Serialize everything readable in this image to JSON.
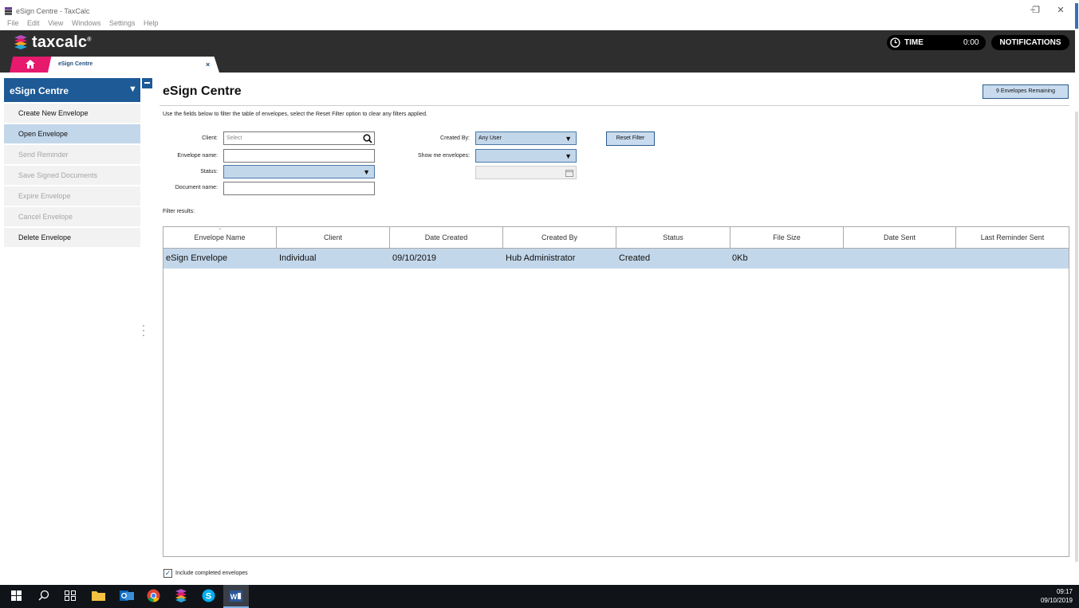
{
  "window": {
    "title": "eSign Centre - TaxCalc",
    "menu": [
      "File",
      "Edit",
      "View",
      "Windows",
      "Settings",
      "Help"
    ],
    "controls": {
      "minimize": "–",
      "restore": "❐",
      "close": "✕"
    }
  },
  "header": {
    "logo_text": "taxcalc",
    "logo_mark": "®",
    "time_label": "TIME",
    "time_value": "0:00",
    "notifications_label": "NOTIFICATIONS"
  },
  "tabs": {
    "active_label": "eSign Centre",
    "close_glyph": "×"
  },
  "sidebar": {
    "title": "eSign Centre",
    "collapse_glyph": "▼",
    "items": [
      {
        "label": "Create New Envelope",
        "enabled": true,
        "selected": false
      },
      {
        "label": "Open Envelope",
        "enabled": true,
        "selected": true
      },
      {
        "label": "Send Reminder",
        "enabled": false,
        "selected": false
      },
      {
        "label": "Save Signed Documents",
        "enabled": false,
        "selected": false
      },
      {
        "label": "Expire Envelope",
        "enabled": false,
        "selected": false
      },
      {
        "label": "Cancel Envelope",
        "enabled": false,
        "selected": false
      },
      {
        "label": "Delete Envelope",
        "enabled": true,
        "selected": false
      }
    ]
  },
  "main": {
    "title": "eSign Centre",
    "envelopes_remaining": "9 Envelopes Remaining",
    "instructions": "Use the fields below to filter the table of envelopes, select the Reset Filter option to clear any filters applied.",
    "filters": {
      "client_label": "Client:",
      "client_placeholder": "Select",
      "envelope_name_label": "Envelope name:",
      "status_label": "Status:",
      "document_name_label": "Document name:",
      "created_by_label": "Created By:",
      "created_by_value": "Any User",
      "show_me_label": "Show me envelopes:",
      "reset_label": "Reset Filter"
    },
    "filter_results_label": "Filter results:",
    "include_completed_label": "Include completed envelopes",
    "include_completed_checked": true
  },
  "table": {
    "columns": [
      "Envelope Name",
      "Client",
      "Date Created",
      "Created By",
      "Status",
      "File Size",
      "Date Sent",
      "Last Reminder Sent"
    ],
    "rows": [
      [
        "eSign Envelope",
        "Individual",
        "09/10/2019",
        "Hub Administrator",
        "Created",
        "0Kb",
        "",
        ""
      ]
    ]
  },
  "taskbar": {
    "time": "09:17",
    "date": "09/10/2019"
  },
  "colors": {
    "brand_blue": "#1d5a96",
    "selection": "#c3d7ea",
    "home_tab": "#e6196d",
    "header_bg": "#2e2e2e"
  }
}
